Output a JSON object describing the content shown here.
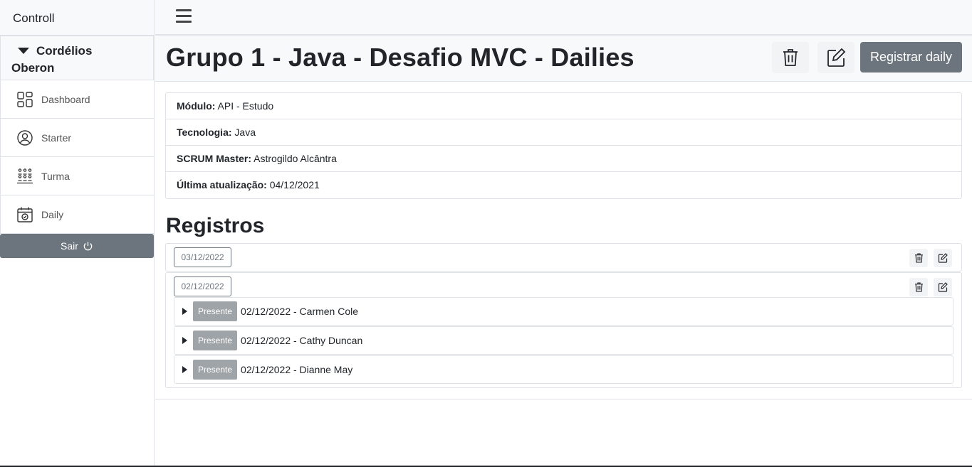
{
  "app": {
    "title": "Controll"
  },
  "user": {
    "name_line1": "Cordélios",
    "name_line2": "Oberon"
  },
  "sidebar": {
    "items": [
      {
        "label": "Dashboard",
        "icon": "dashboard-icon"
      },
      {
        "label": "Starter",
        "icon": "user-circle-icon"
      },
      {
        "label": "Turma",
        "icon": "group-icon"
      },
      {
        "label": "Daily",
        "icon": "calendar-check-icon"
      }
    ],
    "logout_label": "Sair"
  },
  "header": {
    "title": "Grupo 1 - Java - Desafio MVC - Dailies",
    "register_label": "Registrar daily"
  },
  "info": {
    "modulo_label": "Módulo:",
    "modulo_value": "API - Estudo",
    "tecnologia_label": "Tecnologia:",
    "tecnologia_value": "Java",
    "scrum_label": "SCRUM Master:",
    "scrum_value": "Astrogildo Alcântra",
    "ultima_label": "Última atualização:",
    "ultima_value": "04/12/2021"
  },
  "registros": {
    "title": "Registros",
    "entries": [
      {
        "date": "03/12/2022",
        "details": []
      },
      {
        "date": "02/12/2022",
        "details": [
          {
            "badge": "Presente",
            "text": "02/12/2022 - Carmen Cole"
          },
          {
            "badge": "Presente",
            "text": "02/12/2022 - Cathy Duncan"
          },
          {
            "badge": "Presente",
            "text": "02/12/2022 - Dianne May"
          }
        ]
      }
    ]
  },
  "colors": {
    "secondary": "#6c757d",
    "badge": "#9fa4a8",
    "border": "#dee2e6"
  }
}
